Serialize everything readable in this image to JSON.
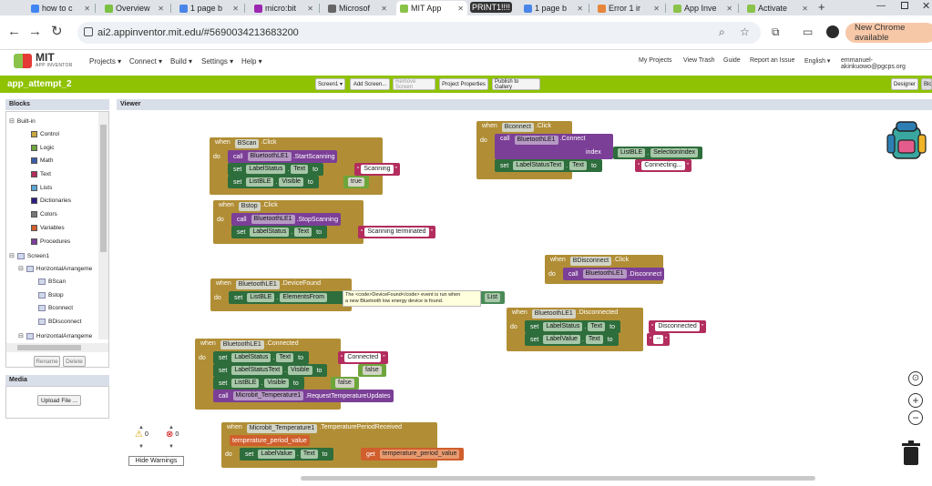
{
  "browser": {
    "tabs": [
      {
        "label": "how to c",
        "color": "#4285f4"
      },
      {
        "label": "Overview",
        "color": "#7ac142"
      },
      {
        "label": "1 page b",
        "color": "#4a86e8"
      },
      {
        "label": "micro:bit",
        "color": "#9c27b0"
      },
      {
        "label": "Microsof",
        "color": "#666666"
      },
      {
        "label": "MIT App",
        "color": "#8bc34a"
      },
      {
        "label": "PRINT1!!!!",
        "color": "#333333"
      },
      {
        "label": "1 page b",
        "color": "#4a86e8"
      },
      {
        "label": "Error 1 ir",
        "color": "#e6863b"
      },
      {
        "label": "App Inve",
        "color": "#8bc34a"
      },
      {
        "label": "Activate",
        "color": "#8bc34a"
      }
    ],
    "url": "ai2.appinventor.mit.edu/#5690034213683200",
    "new_chrome": "New Chrome available"
  },
  "app": {
    "logo_line1": "MIT",
    "logo_line2": "APP INVENTOR",
    "menus": [
      "Projects",
      "Connect",
      "Build",
      "Settings",
      "Help"
    ],
    "right_menus": [
      "My Projects",
      "View Trash",
      "Guide",
      "Report an Issue",
      "English",
      "emmanuel-akinkuowo@pgcps.org"
    ],
    "project_name": "app_attempt_2",
    "toolbar": {
      "screen": "Screen1",
      "add_screen": "Add Screen...",
      "remove_screen": "Remove Screen",
      "project_properties": "Project Properties",
      "publish": "Publish to Gallery",
      "designer": "Designer",
      "blocks": "Blocks"
    }
  },
  "blocks_panel": {
    "title": "Blocks",
    "builtin": "Built-in",
    "categories": [
      {
        "label": "Control",
        "color": "#c8a83e"
      },
      {
        "label": "Logic",
        "color": "#6da53b"
      },
      {
        "label": "Math",
        "color": "#3b5ea8"
      },
      {
        "label": "Text",
        "color": "#b32d5e"
      },
      {
        "label": "Lists",
        "color": "#5ba5d6"
      },
      {
        "label": "Dictionaries",
        "color": "#2d1f82"
      },
      {
        "label": "Colors",
        "color": "#777777"
      },
      {
        "label": "Variables",
        "color": "#d05f2d"
      },
      {
        "label": "Procedures",
        "color": "#7b3f97"
      }
    ],
    "screen": "Screen1",
    "arrangement1": "HorizontalArrangeme",
    "components": [
      "BScan",
      "Bstop",
      "Bconnect",
      "BDisconnect"
    ],
    "arrangement2": "HorizontalArrangeme",
    "rename": "Rename",
    "delete": "Delete"
  },
  "media": {
    "title": "Media",
    "upload": "Upload File ..."
  },
  "viewer": {
    "title": "Viewer",
    "warnings": {
      "warn_count": "0",
      "error_count": "0",
      "hide": "Hide Warnings"
    },
    "tooltip_line1": "The <code>DeviceFound</code> event is run when",
    "tooltip_line2": "a new Bluetooth low energy device is found."
  },
  "code": {
    "when": "when",
    "do": "do",
    "call": "call",
    "set": "set",
    "to": "to",
    "get": "get",
    "index": "index",
    "bscan": {
      "comp": "BScan",
      "event": ".Click",
      "ble": "BluetoothLE1",
      "method": ".StartScanning",
      "lbl": "LabelStatus",
      "prop": "Text",
      "value": "Scanning",
      "list": "ListBLE",
      "prop2": "Visible",
      "value2": "true"
    },
    "bstop": {
      "comp": "Bstop",
      "event": ".Click",
      "ble": "BluetoothLE1",
      "method": ".StopScanning",
      "lbl": "LabelStatus",
      "prop": "Text",
      "value": "Scanning terminated"
    },
    "found": {
      "comp": "BluetoothLE1",
      "event": ".DeviceFound",
      "list": "ListBLE",
      "prop": "ElementsFrom",
      "tail": "List"
    },
    "connected": {
      "comp": "BluetoothLE1",
      "event": ".Connected",
      "lbl1": "LabelStatus",
      "prop1": "Text",
      "value1": "Connected",
      "lbl2": "LabelStatusText",
      "prop2": "Visible",
      "value2": "false",
      "lbl3": "ListBLE",
      "prop3": "Visible",
      "value3": "false",
      "mb": "Microbit_Temperature1",
      "method": ".RequestTemperatureUpdates"
    },
    "temp": {
      "comp": "Microbit_Temperature1",
      "event": ".TemperaturePeriodReceived",
      "param": "temperature_period_value",
      "lbl": "LabelValue",
      "prop": "Text",
      "getvar": "temperature_period_value"
    },
    "bconnect": {
      "comp": "Bconnect",
      "event": ".Click",
      "ble": "BluetoothLE1",
      "method": ".Connect",
      "list": "ListBLE",
      "prop": "SelectionIndex",
      "lbl": "LabelStatusText",
      "prop2": "Text",
      "value": "Connecting..."
    },
    "bdisconnect": {
      "comp": "BDisconnect",
      "event": ".Click",
      "ble": "BluetoothLE1",
      "method": ".Disconnect"
    },
    "disconnected": {
      "comp": "BluetoothLE1",
      "event": ".Disconnected",
      "lbl1": "LabelStatus",
      "prop1": "Text",
      "value1": "Disconnected",
      "lbl2": "LabelValue",
      "prop2": "Text",
      "value2": "--"
    }
  }
}
